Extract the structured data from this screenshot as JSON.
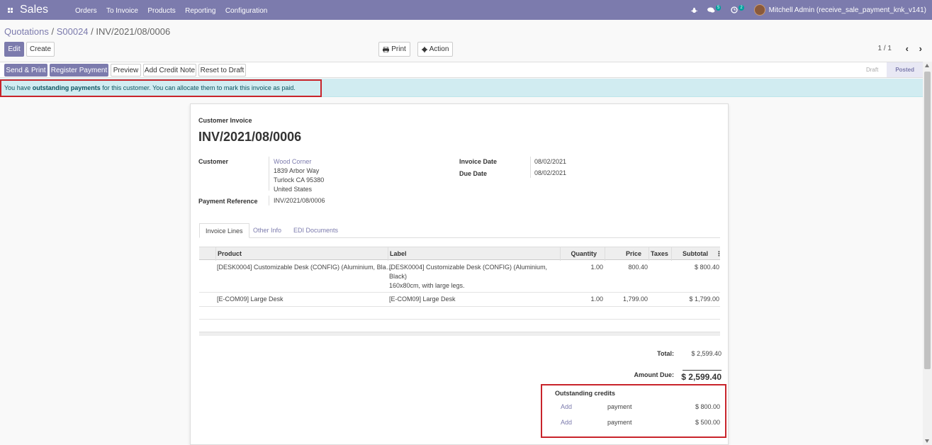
{
  "navbar": {
    "app_name": "Sales",
    "menu": [
      "Orders",
      "To Invoice",
      "Products",
      "Reporting",
      "Configuration"
    ],
    "messages_count": "5",
    "activities_count": "2",
    "user": "Mitchell Admin (receive_sale_payment_knk_v141)"
  },
  "breadcrumb": {
    "part1": "Quotations",
    "sep1": " / ",
    "part2": "S00024",
    "sep2": " / ",
    "current": "INV/2021/08/0006"
  },
  "controls": {
    "edit": "Edit",
    "create": "Create",
    "print": "Print",
    "action": "Action",
    "pager": "1 / 1"
  },
  "statusbar": {
    "send_print": "Send & Print",
    "register_payment": "Register Payment",
    "preview": "Preview",
    "add_credit_note": "Add Credit Note",
    "reset_to_draft": "Reset to Draft",
    "stages": [
      "Draft",
      "Posted"
    ],
    "active_stage": "Posted"
  },
  "alert": {
    "pre": "You have ",
    "bold": "outstanding payments",
    "post": " for this customer. You can allocate them to mark this invoice as paid."
  },
  "invoice": {
    "type_label": "Customer Invoice",
    "number": "INV/2021/08/0006",
    "customer_label": "Customer",
    "customer_name": "Wood Corner",
    "address1": "1839 Arbor Way",
    "address2": "Turlock CA 95380",
    "address3": "United States",
    "payment_ref_label": "Payment Reference",
    "payment_ref": "INV/2021/08/0006",
    "invoice_date_label": "Invoice Date",
    "invoice_date": "08/02/2021",
    "due_date_label": "Due Date",
    "due_date": "08/02/2021"
  },
  "tabs": [
    "Invoice Lines",
    "Other Info",
    "EDI Documents"
  ],
  "table": {
    "headers": [
      "Product",
      "Label",
      "Quantity",
      "Price",
      "Taxes",
      "Subtotal"
    ],
    "rows": [
      {
        "product": "[DESK0004] Customizable Desk (CONFIG) (Aluminium, Bla…",
        "label1": "[DESK0004] Customizable Desk (CONFIG) (Aluminium,",
        "label2": "Black)",
        "label3": "160x80cm, with large legs.",
        "quantity": "1.00",
        "price": "800.40",
        "taxes": "",
        "subtotal": "$ 800.40"
      },
      {
        "product": "[E-COM09] Large Desk",
        "label1": "[E-COM09] Large Desk",
        "label2": "",
        "label3": "",
        "quantity": "1.00",
        "price": "1,799.00",
        "taxes": "",
        "subtotal": "$ 1,799.00"
      }
    ]
  },
  "totals": {
    "total_label": "Total:",
    "total": "$ 2,599.40",
    "amount_due_label": "Amount Due:",
    "amount_due": "$ 2,599.40"
  },
  "credits": {
    "title": "Outstanding credits",
    "items": [
      {
        "action": "Add",
        "desc": "payment",
        "amount": "$ 800.00"
      },
      {
        "action": "Add",
        "desc": "payment",
        "amount": "$ 500.00"
      }
    ]
  },
  "colors": {
    "brand": "#7c7bad",
    "highlight": "#c8242b",
    "alert_bg": "#d1ecf1"
  }
}
